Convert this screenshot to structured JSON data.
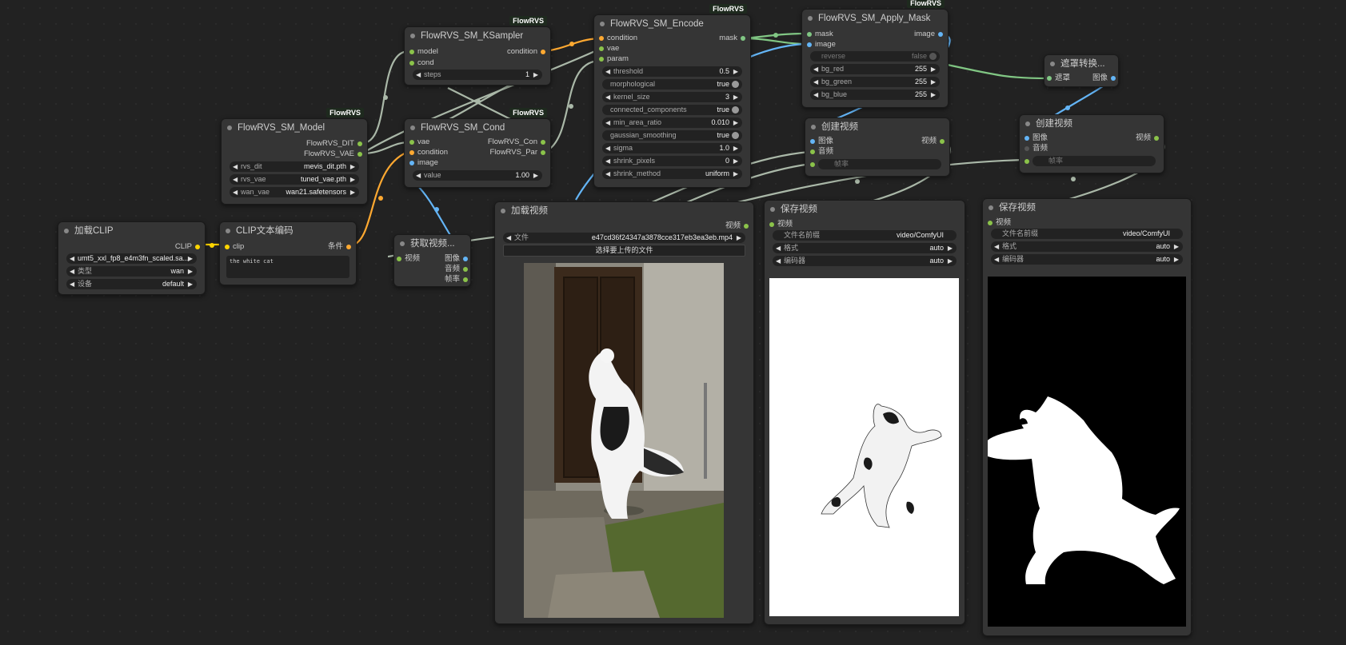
{
  "colors": {
    "canvas": "#222222",
    "node_bg": "#353535",
    "wire_model": "#aab8a8",
    "wire_clip": "#ffd500",
    "wire_cond": "#ffa931",
    "wire_image": "#64b5f6",
    "wire_mask": "#81c784"
  },
  "badge": "FlowRVS",
  "load_clip": {
    "title": "加载CLIP",
    "out_clip": "CLIP",
    "w_name": "umt5_xxl_fp8_e4m3fn_scaled.sa...",
    "w_type_label": "类型",
    "w_type_value": "wan",
    "w_device_label": "设备",
    "w_device_value": "default"
  },
  "clip_text": {
    "title": "CLIP文本编码",
    "in_clip": "clip",
    "out_cond": "条件",
    "text": "the white cat"
  },
  "model": {
    "title": "FlowRVS_SM_Model",
    "out_dit": "FlowRVS_DIT",
    "out_vae": "FlowRVS_VAE",
    "w1_label": "rvs_dit",
    "w1_value": "mevis_dit.pth",
    "w2_label": "rvs_vae",
    "w2_value": "tuned_vae.pth",
    "w3_label": "wan_vae",
    "w3_value": "wan21.safetensors"
  },
  "ksampler": {
    "title": "FlowRVS_SM_KSampler",
    "in_model": "model",
    "in_cond": "cond",
    "out_condition": "condition",
    "w_steps_label": "steps",
    "w_steps_value": "1"
  },
  "cond": {
    "title": "FlowRVS_SM_Cond",
    "in_vae": "vae",
    "in_condition": "condition",
    "in_image": "image",
    "out_con": "FlowRVS_Con",
    "out_par": "FlowRVS_Par",
    "w_value_label": "value",
    "w_value_value": "1.00"
  },
  "encode": {
    "title": "FlowRVS_SM_Encode",
    "in_condition": "condition",
    "in_vae": "vae",
    "in_param": "param",
    "out_mask": "mask",
    "widgets": [
      {
        "label": "threshold",
        "value": "0.5"
      },
      {
        "label": "morphological",
        "value": "true"
      },
      {
        "label": "kernel_size",
        "value": "3"
      },
      {
        "label": "connected_components",
        "value": "true"
      },
      {
        "label": "min_area_ratio",
        "value": "0.010"
      },
      {
        "label": "gaussian_smoothing",
        "value": "true"
      },
      {
        "label": "sigma",
        "value": "1.0"
      },
      {
        "label": "shrink_pixels",
        "value": "0"
      },
      {
        "label": "shrink_method",
        "value": "uniform"
      }
    ]
  },
  "apply_mask": {
    "title": "FlowRVS_SM_Apply_Mask",
    "in_mask": "mask",
    "in_image": "image",
    "out_image": "image",
    "w_reverse_label": "reverse",
    "w_reverse_value": "false",
    "w_red_label": "bg_red",
    "w_red_value": "255",
    "w_green_label": "bg_green",
    "w_green_value": "255",
    "w_blue_label": "bg_blue",
    "w_blue_value": "255"
  },
  "mask_convert": {
    "title": "遮罩转换...",
    "in_mask": "遮罩",
    "out_image": "图像"
  },
  "create_video_1": {
    "title": "创建视频",
    "in_image": "图像",
    "in_audio": "音频",
    "in_fps": "帧率",
    "out_video": "视频"
  },
  "create_video_2": {
    "title": "创建视频",
    "in_image": "图像",
    "in_audio": "音频",
    "in_fps": "帧率",
    "out_video": "视频"
  },
  "get_video": {
    "title": "获取视频...",
    "in_video": "视频",
    "out_image": "图像",
    "out_audio": "音频",
    "out_fps": "帧率"
  },
  "load_video": {
    "title": "加载视频",
    "out_video": "视频",
    "w_file_label": "文件",
    "w_file_value": "e47cd36f24347a3878cce317eb3ea3eb.mp4",
    "upload_button": "选择要上传的文件"
  },
  "save_video_1": {
    "title": "保存视频",
    "in_video": "视频",
    "w_prefix_label": "文件名前缀",
    "w_prefix_value": "video/ComfyUI",
    "w_format_label": "格式",
    "w_format_value": "auto",
    "w_codec_label": "编码器",
    "w_codec_value": "auto"
  },
  "save_video_2": {
    "title": "保存视频",
    "in_video": "视频",
    "w_prefix_label": "文件名前缀",
    "w_prefix_value": "video/ComfyUI",
    "w_format_label": "格式",
    "w_format_value": "auto",
    "w_codec_label": "编码器",
    "w_codec_value": "auto"
  }
}
